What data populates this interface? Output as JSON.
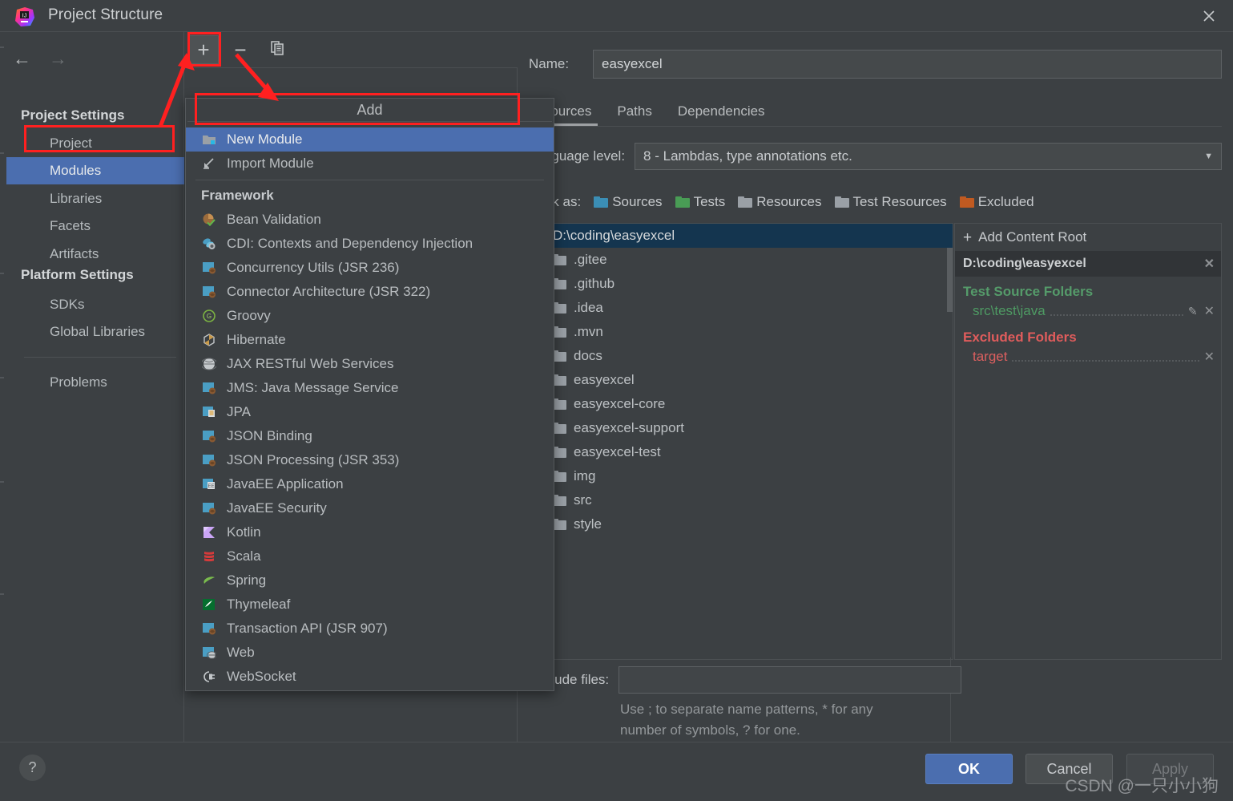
{
  "window": {
    "title": "Project Structure",
    "logo_icon": "intellij-idea-logo",
    "close_icon": "close-icon"
  },
  "sidebar": {
    "back_icon": "arrow-left-icon",
    "forward_icon": "arrow-right-icon",
    "groups": [
      {
        "title": "Project Settings",
        "items": [
          "Project",
          "Modules",
          "Libraries",
          "Facets",
          "Artifacts"
        ]
      },
      {
        "title": "Platform Settings",
        "items": [
          "SDKs",
          "Global Libraries"
        ]
      }
    ],
    "extra_items": [
      "Problems"
    ],
    "selected": "Modules"
  },
  "toolbar": {
    "add_icon": "plus-icon",
    "remove_icon": "minus-icon",
    "copy_icon": "copy-icon",
    "add_label": "+",
    "remove_label": "−"
  },
  "menu": {
    "title": "Add",
    "items": [
      {
        "label": "New Module",
        "icon": "new-module-folder-icon",
        "highlighted": true
      },
      {
        "label": "Import Module",
        "icon": "import-module-icon",
        "highlighted": false
      }
    ],
    "section_title": "Framework",
    "frameworks": [
      {
        "label": "Bean Validation",
        "icon": "bean-validation-icon"
      },
      {
        "label": "CDI: Contexts and Dependency Injection",
        "icon": "cdi-icon"
      },
      {
        "label": "Concurrency Utils (JSR 236)",
        "icon": "java-ee-icon"
      },
      {
        "label": "Connector Architecture (JSR 322)",
        "icon": "java-ee-icon"
      },
      {
        "label": "Groovy",
        "icon": "groovy-icon"
      },
      {
        "label": "Hibernate",
        "icon": "hibernate-icon"
      },
      {
        "label": "JAX RESTful Web Services",
        "icon": "globe-icon"
      },
      {
        "label": "JMS: Java Message Service",
        "icon": "java-ee-icon"
      },
      {
        "label": "JPA",
        "icon": "jpa-icon"
      },
      {
        "label": "JSON Binding",
        "icon": "java-ee-icon"
      },
      {
        "label": "JSON Processing (JSR 353)",
        "icon": "java-ee-icon"
      },
      {
        "label": "JavaEE Application",
        "icon": "javaee-app-icon"
      },
      {
        "label": "JavaEE Security",
        "icon": "java-ee-icon"
      },
      {
        "label": "Kotlin",
        "icon": "kotlin-icon"
      },
      {
        "label": "Scala",
        "icon": "scala-icon"
      },
      {
        "label": "Spring",
        "icon": "spring-leaf-icon"
      },
      {
        "label": "Thymeleaf",
        "icon": "thymeleaf-icon"
      },
      {
        "label": "Transaction API (JSR 907)",
        "icon": "java-ee-icon"
      },
      {
        "label": "Web",
        "icon": "web-icon"
      },
      {
        "label": "WebSocket",
        "icon": "websocket-icon"
      }
    ]
  },
  "detail": {
    "name_label": "Name:",
    "name_value": "easyexcel",
    "tabs": [
      {
        "label": "Sources",
        "active": true
      },
      {
        "label": "Paths",
        "active": false
      },
      {
        "label": "Dependencies",
        "active": false
      }
    ],
    "language_level_label": "Language level:",
    "language_level_value": "8 - Lambdas, type annotations etc.",
    "caret_icon": "chevron-down-icon",
    "mark_as_label": "Mark as:",
    "mark_as": [
      {
        "label": "Sources",
        "mnemonic": "S",
        "rest": "ources",
        "color": "blue",
        "icon": "folder-sources-icon"
      },
      {
        "label": "Tests",
        "mnemonic": "T",
        "rest": "ests",
        "color": "green",
        "icon": "folder-tests-icon"
      },
      {
        "label": "Resources",
        "mnemonic": "",
        "rest": "Resources",
        "color": "lgrey",
        "icon": "folder-resources-icon"
      },
      {
        "label": "Test Resources",
        "mnemonic": "",
        "rest": "Test Resources",
        "color": "lgrey",
        "icon": "folder-test-resources-icon"
      },
      {
        "label": "Excluded",
        "mnemonic": "E",
        "rest": "xcluded",
        "color": "orange",
        "icon": "folder-excluded-icon"
      }
    ],
    "tree": {
      "root": "D:\\coding\\easyexcel",
      "root_icon": "module-root-icon",
      "children": [
        ".gitee",
        ".github",
        ".idea",
        ".mvn",
        "docs",
        "easyexcel",
        "easyexcel-core",
        "easyexcel-support",
        "easyexcel-test",
        "img",
        "src",
        "style"
      ],
      "folder_icon": "folder-icon"
    },
    "content_root": {
      "add_label": "Add Content Root",
      "add_mnemonic": "C",
      "add_icon": "plus-icon",
      "path": "D:\\coding\\easyexcel",
      "remove_icon": "close-icon",
      "sections": [
        {
          "title": "Test Source Folders",
          "color": "#559b6a",
          "entries": [
            {
              "label": "src\\test\\java",
              "edit_icon": "pencil-icon",
              "remove_icon": "close-icon",
              "has_edit": true
            }
          ]
        },
        {
          "title": "Excluded Folders",
          "color": "#e05c5c",
          "entries": [
            {
              "label": "target",
              "remove_icon": "close-icon",
              "has_edit": false
            }
          ]
        }
      ]
    },
    "exclude_files_label": "Exclude files:",
    "exclude_files_value": "",
    "exclude_hint_line1": "Use ; to separate name patterns, * for any",
    "exclude_hint_line2": "number of symbols, ? for one."
  },
  "footer": {
    "help_label": "?",
    "help_icon": "help-icon",
    "ok": "OK",
    "cancel": "Cancel",
    "apply": "Apply"
  },
  "watermark": "CSDN @一只小小狗",
  "colors": {
    "accent_blue": "#4b6eaf",
    "annotation_red": "#ff2020",
    "green": "#559b6a",
    "red": "#e05c5c",
    "background": "#3c4043"
  }
}
